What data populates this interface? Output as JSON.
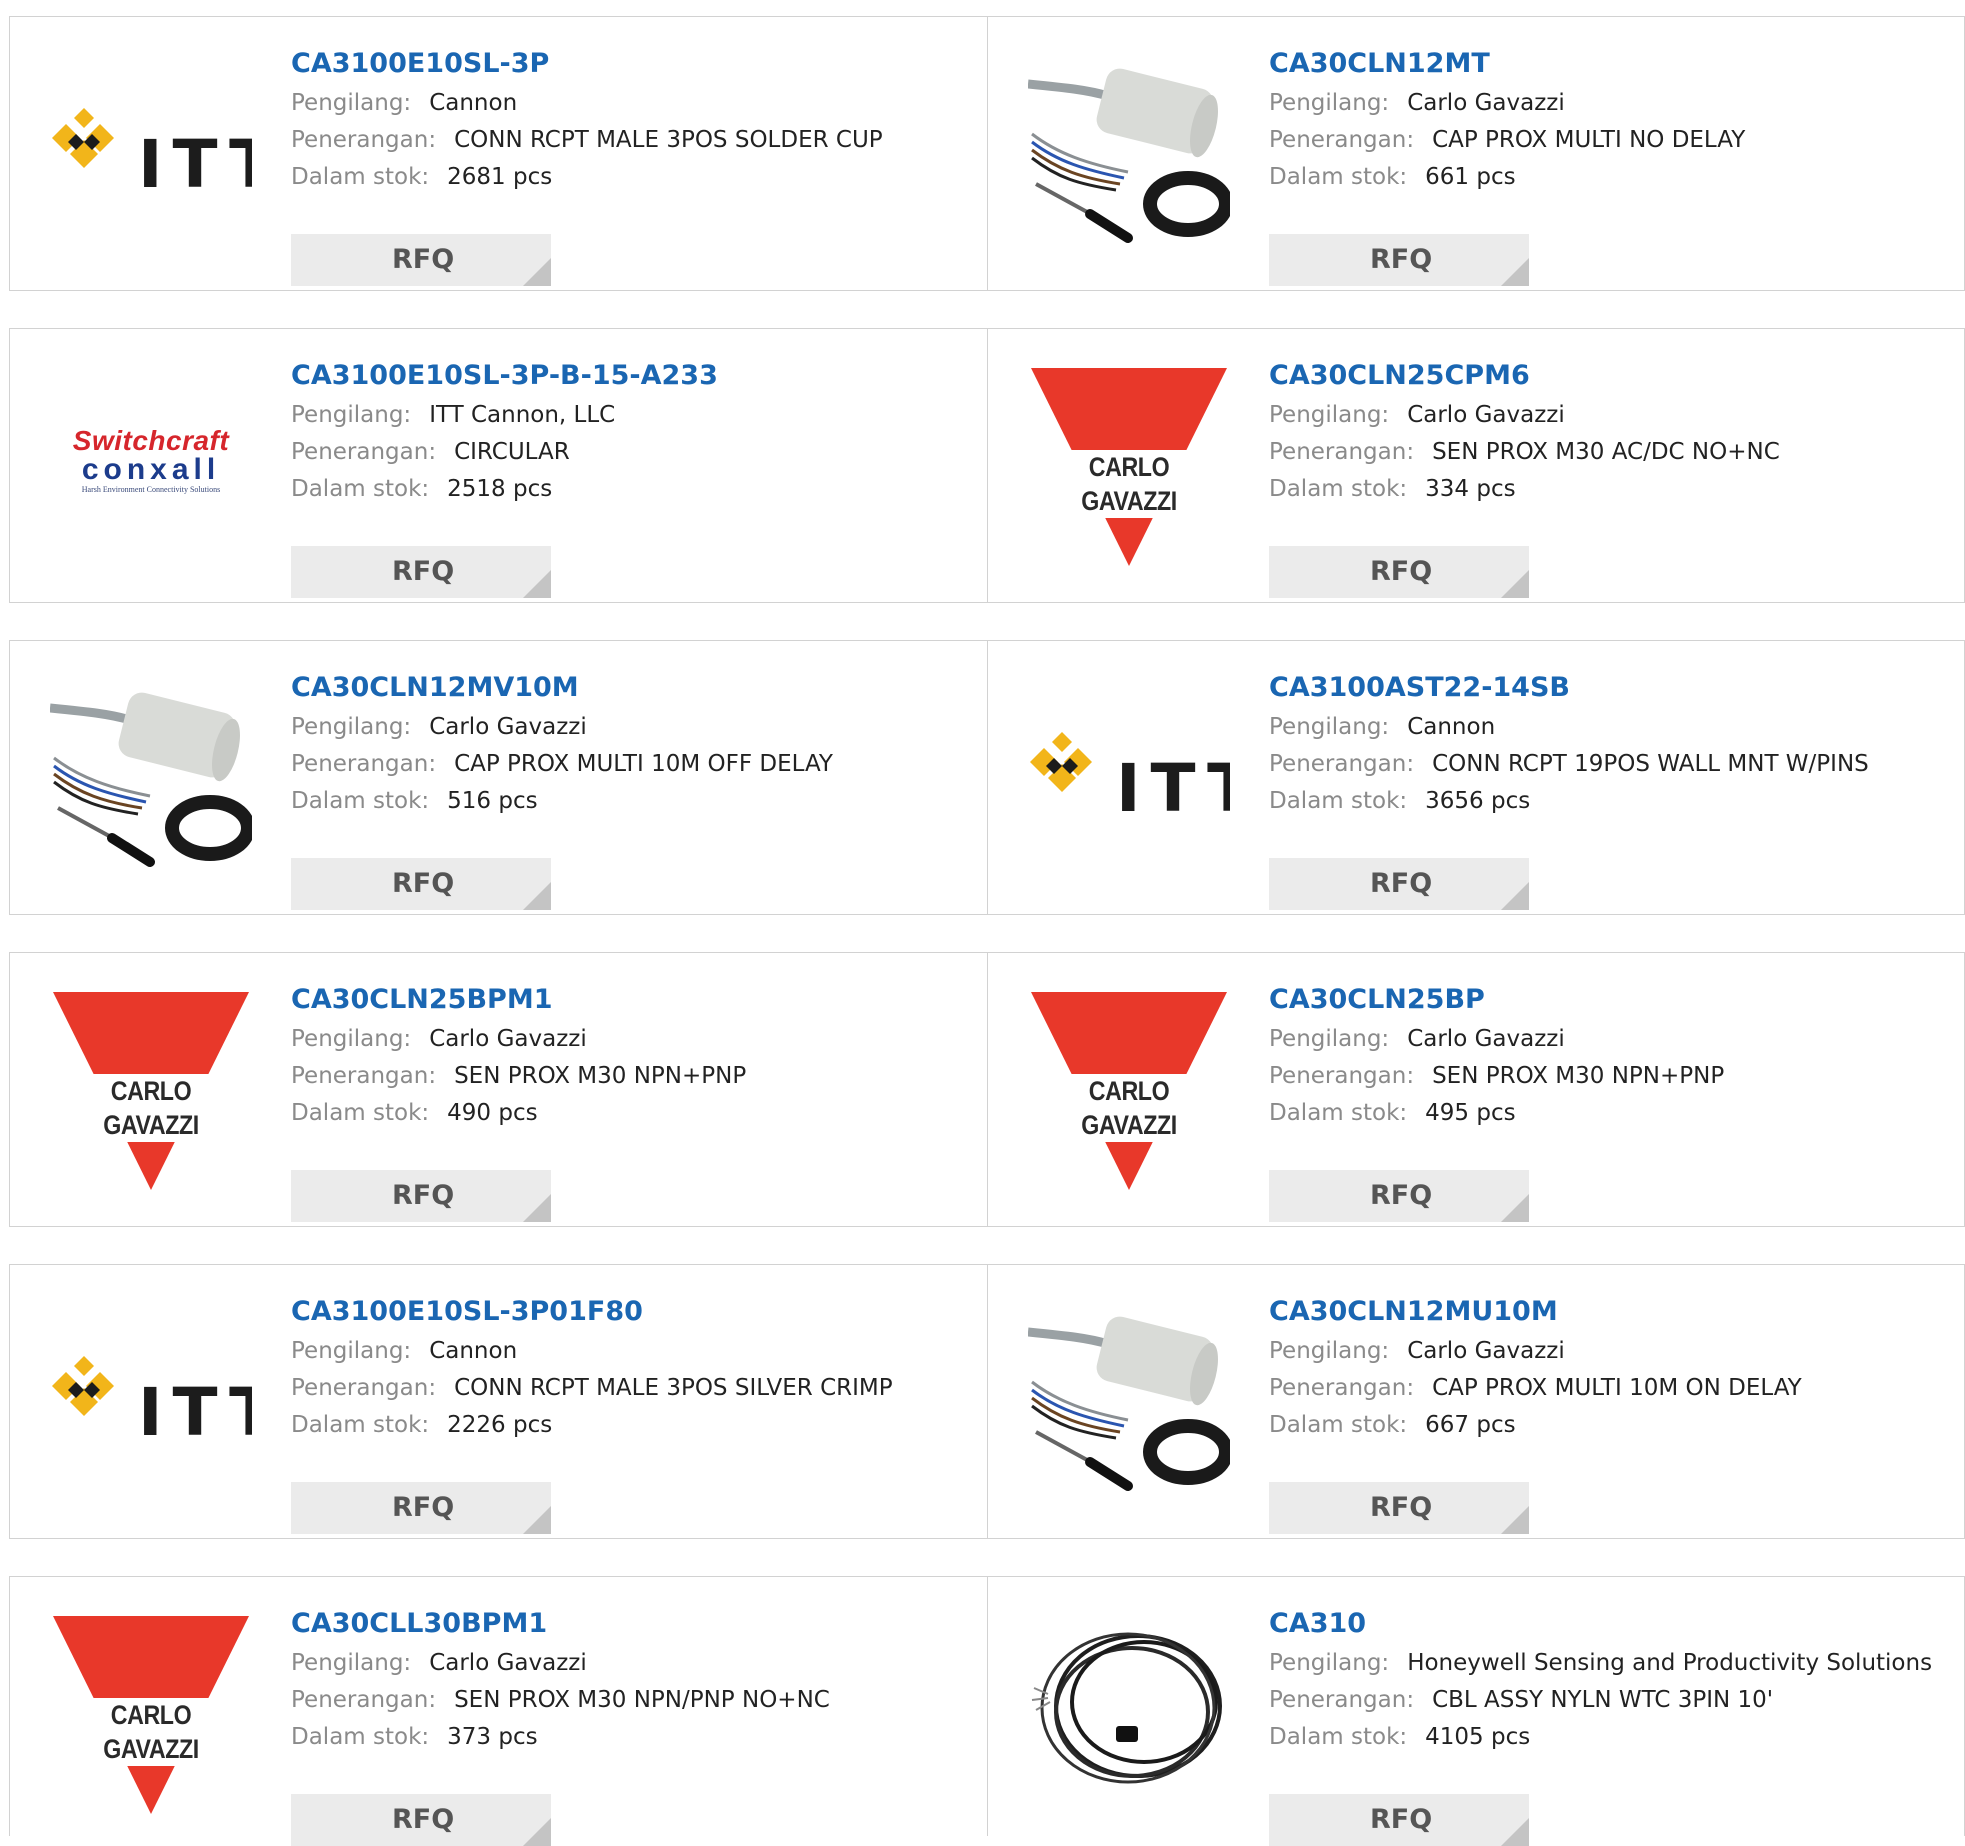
{
  "labels": {
    "manufacturer": "Pengilang:",
    "description": "Penerangan:",
    "stock": "Dalam stok:",
    "rfq": "RFQ"
  },
  "logos": {
    "itt": "ITT",
    "carlo_gavazzi": "CARLO GAVAZZI",
    "switchcraft_top": "Switchcraft",
    "switchcraft_mid": "conxall",
    "switchcraft_tag": "Harsh Environment Connectivity Solutions"
  },
  "colors": {
    "part_number": "#1a66b2",
    "label_gray": "#8a8a8a",
    "value_dark": "#222222",
    "rfq_bg": "#ebebeb",
    "cg_red": "#e8382a",
    "itt_gold": "#f2b51a"
  },
  "products": [
    {
      "part": "CA3100E10SL-3P",
      "manufacturer": "Cannon",
      "description": "CONN RCPT MALE 3POS SOLDER CUP",
      "stock": "2681 pcs",
      "image": "itt-logo"
    },
    {
      "part": "CA30CLN12MT",
      "manufacturer": "Carlo Gavazzi",
      "description": "CAP PROX MULTI NO DELAY",
      "stock": "661 pcs",
      "image": "proximity-sensor-photo"
    },
    {
      "part": "CA3100E10SL-3P-B-15-A233",
      "manufacturer": "ITT Cannon, LLC",
      "description": "CIRCULAR",
      "stock": "2518 pcs",
      "image": "switchcraft-conxall-logo"
    },
    {
      "part": "CA30CLN25CPM6",
      "manufacturer": "Carlo Gavazzi",
      "description": "SEN PROX M30 AC/DC NO+NC",
      "stock": "334 pcs",
      "image": "carlo-gavazzi-logo"
    },
    {
      "part": "CA30CLN12MV10M",
      "manufacturer": "Carlo Gavazzi",
      "description": "CAP PROX MULTI 10M OFF DELAY",
      "stock": "516 pcs",
      "image": "proximity-sensor-photo"
    },
    {
      "part": "CA3100AST22-14SB",
      "manufacturer": "Cannon",
      "description": "CONN RCPT 19POS WALL MNT W/PINS",
      "stock": "3656 pcs",
      "image": "itt-logo"
    },
    {
      "part": "CA30CLN25BPM1",
      "manufacturer": "Carlo Gavazzi",
      "description": "SEN PROX M30 NPN+PNP",
      "stock": "490 pcs",
      "image": "carlo-gavazzi-logo"
    },
    {
      "part": "CA30CLN25BP",
      "manufacturer": "Carlo Gavazzi",
      "description": "SEN PROX M30 NPN+PNP",
      "stock": "495 pcs",
      "image": "carlo-gavazzi-logo"
    },
    {
      "part": "CA3100E10SL-3P01F80",
      "manufacturer": "Cannon",
      "description": "CONN RCPT MALE 3POS SILVER CRIMP",
      "stock": "2226 pcs",
      "image": "itt-logo"
    },
    {
      "part": "CA30CLN12MU10M",
      "manufacturer": "Carlo Gavazzi",
      "description": "CAP PROX MULTI 10M ON DELAY",
      "stock": "667 pcs",
      "image": "proximity-sensor-photo"
    },
    {
      "part": "CA30CLL30BPM1",
      "manufacturer": "Carlo Gavazzi",
      "description": "SEN PROX M30 NPN/PNP NO+NC",
      "stock": "373 pcs",
      "image": "carlo-gavazzi-logo"
    },
    {
      "part": "CA310",
      "manufacturer": "Honeywell Sensing and Productivity Solutions",
      "description": "CBL ASSY NYLN WTC 3PIN 10'",
      "stock": "4105 pcs",
      "image": "cable-assembly-photo"
    }
  ]
}
